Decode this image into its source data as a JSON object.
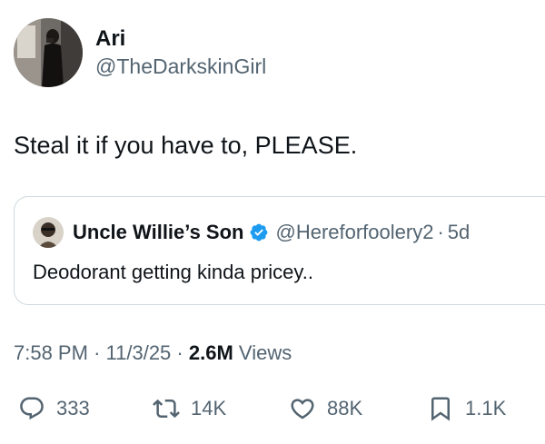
{
  "author": {
    "display_name": "Ari",
    "handle": "@TheDarkskinGirl"
  },
  "tweet": {
    "text": "Steal it if you have to, PLEASE."
  },
  "quoted_tweet": {
    "display_name": "Uncle Willie’s Son",
    "verified": true,
    "handle": "@Hereforfoolery2",
    "separator": "·",
    "time": "5d",
    "text": "Deodorant getting kinda pricey.."
  },
  "meta": {
    "time": "7:58 PM",
    "sep1": "·",
    "date": "11/3/25",
    "sep2": "·",
    "views_count": "2.6M",
    "views_label": "Views"
  },
  "actions": {
    "replies": "333",
    "reposts": "14K",
    "likes": "88K",
    "bookmarks": "1.1K"
  },
  "colors": {
    "text": "#0f1419",
    "secondary": "#536471",
    "border": "#cfd9de",
    "verified_badge": "#1d9bf0"
  },
  "icons": [
    "reply-icon",
    "repost-icon",
    "like-icon",
    "bookmark-icon",
    "verified-badge-icon"
  ]
}
